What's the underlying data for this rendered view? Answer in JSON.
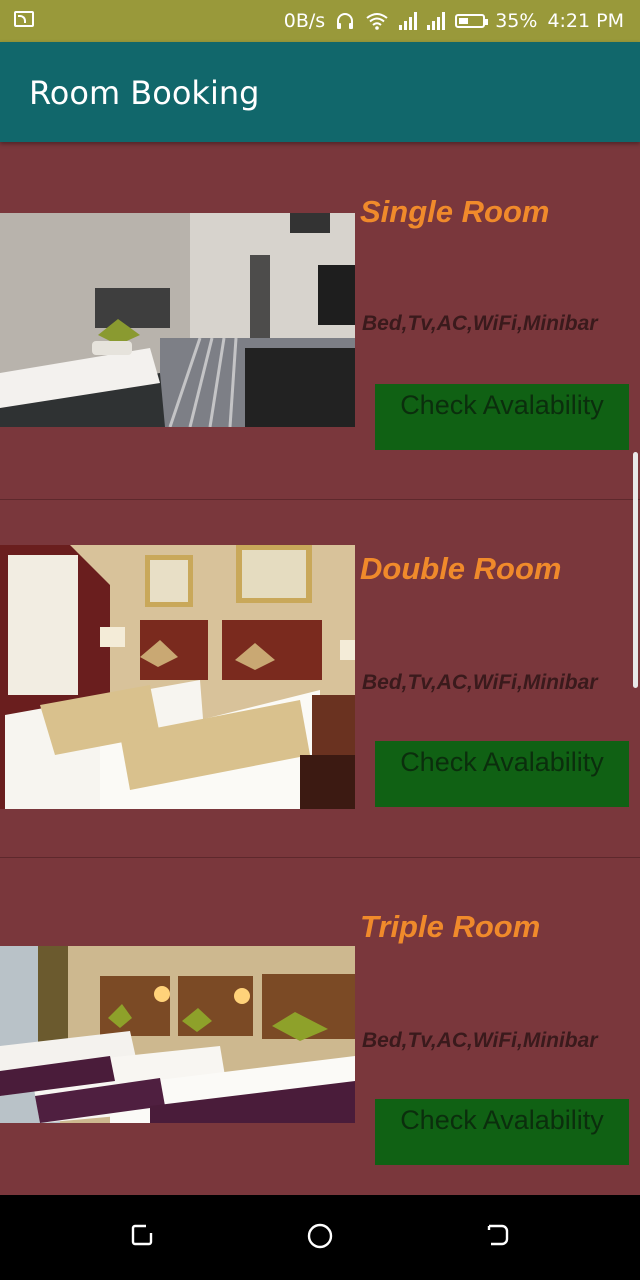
{
  "status_bar": {
    "net_speed": "0B/s",
    "battery": "35%",
    "time": "4:21 PM",
    "icons": [
      "cast-icon",
      "headphones-icon",
      "wifi-icon",
      "signal-icon",
      "signal-icon",
      "battery-icon"
    ]
  },
  "app_bar": {
    "title": "Room Booking"
  },
  "rooms": [
    {
      "name": "Single Room",
      "amenities": "Bed,Tv,AC,WiFi,Minibar",
      "button": "Check Avalability"
    },
    {
      "name": "Double Room",
      "amenities": "Bed,Tv,AC,WiFi,Minibar",
      "button": "Check Avalability"
    },
    {
      "name": "Triple Room",
      "amenities": "Bed,Tv,AC,WiFi,Minibar",
      "button": "Check Avalability"
    }
  ],
  "nav_bar": {
    "icons": [
      "recents-icon",
      "home-icon",
      "back-icon"
    ]
  },
  "colors": {
    "status_bar": "#99993a",
    "app_bar": "#11676b",
    "background": "#7a373c",
    "room_title": "#f08a2b",
    "button": "#106114"
  }
}
